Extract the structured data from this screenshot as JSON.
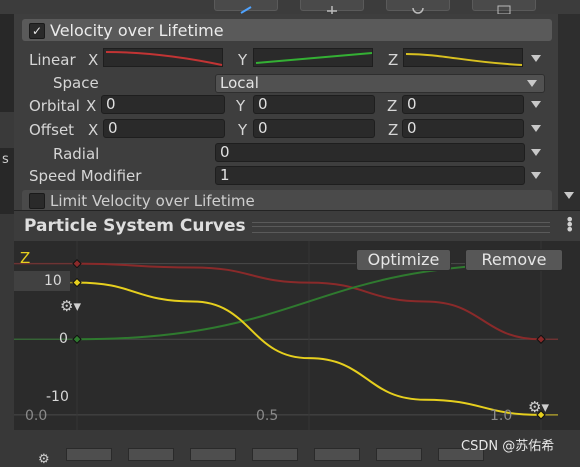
{
  "modules": {
    "velocity_over_lifetime": {
      "label": "Velocity over Lifetime",
      "enabled": true
    },
    "limit_velocity_over_lifetime": {
      "label": "Limit Velocity over Lifetime",
      "enabled": false
    }
  },
  "rows": {
    "linear": {
      "label": "Linear",
      "x_axis": "X",
      "y_axis": "Y",
      "z_axis": "Z"
    },
    "space": {
      "label": "Space",
      "value": "Local"
    },
    "orbital": {
      "label": "Orbital",
      "x_axis": "X",
      "x": "0",
      "y_axis": "Y",
      "y": "0",
      "z_axis": "Z",
      "z": "0"
    },
    "offset": {
      "label": "Offset",
      "x_axis": "X",
      "x": "0",
      "y_axis": "Y",
      "y": "0",
      "z_axis": "Z",
      "z": "0"
    },
    "radial": {
      "label": "Radial",
      "value": "0"
    },
    "speed_modifier": {
      "label": "Speed Modifier",
      "value": "1"
    }
  },
  "curves_panel": {
    "title": "Particle System Curves",
    "axis_label": "Z",
    "optimize_label": "Optimize",
    "remove_label": "Remove",
    "y_ticks": [
      "10",
      "0",
      "-10"
    ],
    "x_ticks": [
      "0.0",
      "0.5",
      "1.0"
    ],
    "colors": {
      "red": "#8a2a2a",
      "green": "#2f7a2f",
      "yellow": "#e6cf1e"
    }
  },
  "chart_data": {
    "type": "line",
    "xlim": [
      0,
      1
    ],
    "ylim": [
      -12,
      13
    ],
    "series": [
      {
        "color": "#8a2a2a",
        "x": [
          0.0,
          0.25,
          0.5,
          0.75,
          1.0
        ],
        "y": [
          10,
          9.5,
          7.5,
          5,
          0
        ]
      },
      {
        "color": "#2f7a2f",
        "x": [
          0.0,
          1.0
        ],
        "y": [
          0,
          10
        ]
      },
      {
        "color": "#e6cf1e",
        "x": [
          0.0,
          0.25,
          0.5,
          0.75,
          1.0
        ],
        "y": [
          7.5,
          5,
          -2.5,
          -8,
          -10
        ]
      }
    ]
  },
  "watermark": "CSDN @苏佑希"
}
